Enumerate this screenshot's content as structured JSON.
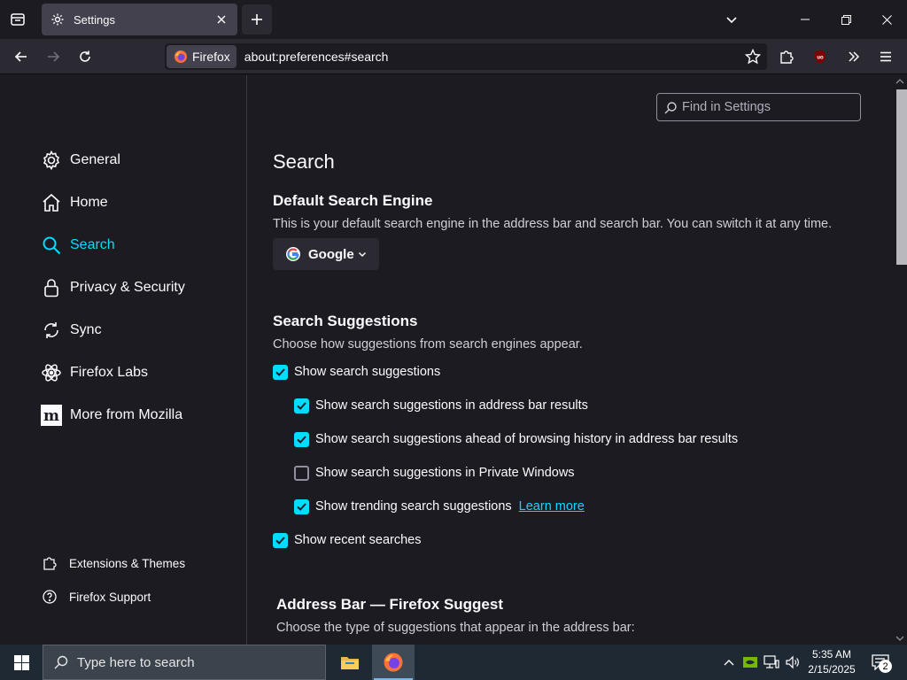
{
  "tab": {
    "title": "Settings"
  },
  "urlbar": {
    "identity_label": "Firefox",
    "url": "about:preferences#search"
  },
  "find": {
    "placeholder": "Find in Settings"
  },
  "sidebar": {
    "categories": [
      {
        "label": "General",
        "icon": "gear-icon"
      },
      {
        "label": "Home",
        "icon": "home-icon"
      },
      {
        "label": "Search",
        "icon": "search-icon",
        "selected": true
      },
      {
        "label": "Privacy & Security",
        "icon": "lock-icon"
      },
      {
        "label": "Sync",
        "icon": "sync-icon"
      },
      {
        "label": "Firefox Labs",
        "icon": "labs-icon"
      },
      {
        "label": "More from Mozilla",
        "icon": "mozilla-icon"
      }
    ],
    "footer": [
      {
        "label": "Extensions & Themes",
        "icon": "puzzle-icon"
      },
      {
        "label": "Firefox Support",
        "icon": "help-icon"
      }
    ]
  },
  "main": {
    "title": "Search",
    "default_engine": {
      "heading": "Default Search Engine",
      "description": "This is your default search engine in the address bar and search bar. You can switch it at any time.",
      "selected": "Google"
    },
    "suggestions": {
      "heading": "Search Suggestions",
      "description": "Choose how suggestions from search engines appear.",
      "options": [
        {
          "label": "Show search suggestions",
          "checked": true
        },
        {
          "label": "Show search suggestions in address bar results",
          "checked": true
        },
        {
          "label": "Show search suggestions ahead of browsing history in address bar results",
          "checked": true
        },
        {
          "label": "Show search suggestions in Private Windows",
          "checked": false
        },
        {
          "label": "Show trending search suggestions",
          "checked": true,
          "link": "Learn more"
        },
        {
          "label": "Show recent searches",
          "checked": true
        }
      ]
    },
    "address_bar": {
      "heading": "Address Bar — Firefox Suggest",
      "description": "Choose the type of suggestions that appear in the address bar:"
    }
  },
  "taskbar": {
    "search_placeholder": "Type here to search",
    "time": "5:35 AM",
    "date": "2/15/2025",
    "notification_count": "2"
  },
  "colors": {
    "accent": "#00ddff",
    "background": "#1c1b22",
    "toolbar": "#2b2a33"
  }
}
